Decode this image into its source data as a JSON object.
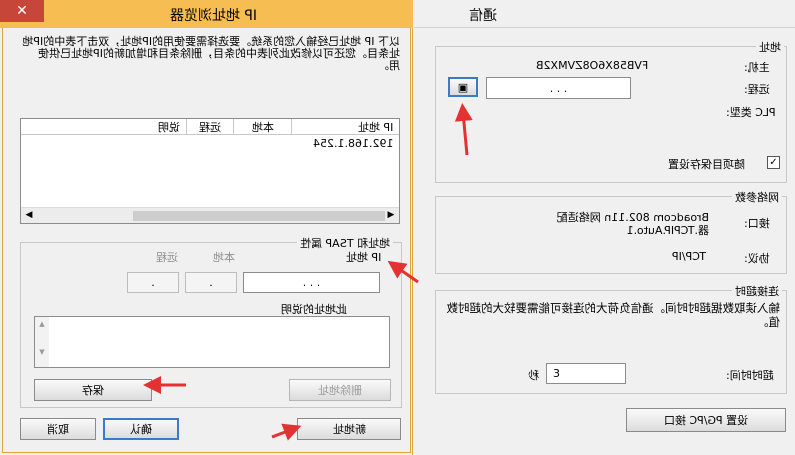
{
  "browser": {
    "title": "IP 地址浏览器",
    "close": "✕",
    "intro": "以下 IP 地址已经输入您的系统。要选择需要使用的IP地址，双击下表中的IP地址条目。您还可以修改此列表中的条目，删除条目和增加新的IP地址已供使用。",
    "table": {
      "columns": [
        "IP 地址",
        "本地",
        "远程",
        "说明"
      ],
      "rows": [
        [
          "192.168.1.254",
          "",
          "",
          ""
        ]
      ]
    },
    "group_title": "地址和 TSAP 属性",
    "ip_label": "IP 地址",
    "ip_value": ". . .",
    "local_label": "本地",
    "local_value": ".",
    "remote_label": "远程",
    "remote_value": ".",
    "desc_label": "此地址的说明",
    "save": "保存",
    "delete": "删除地址",
    "ok": "确认",
    "cancel": "取消",
    "new": "新地址"
  },
  "comm": {
    "title": "通信",
    "address_group": "地址",
    "host_label": "主机:",
    "host_value": "FVB58X6O8ZVMX2B",
    "remote_label": "远程:",
    "remote_value": ". . .",
    "plc_type_label": "PLC 类型:",
    "save_with_project_label": "随项目保存设置",
    "network_group": "网络参数",
    "interface_label": "接口:",
    "interface_value": "Broadcom 802.11n 网络适配器.TCPIP.Auto.1",
    "protocol_label": "协议:",
    "protocol_value": "TCP/IP",
    "timeout_group": "连接超时",
    "timeout_desc": "输入读取数据超时时间。通信负荷大的连接可能需要较大的超时数值。",
    "timeout_label": "超时时间:",
    "timeout_value": "3",
    "timeout_unit": "秒",
    "pg_pc_button": "设置 PG/PC 接口"
  },
  "colors": {
    "title_bar": "#f6bd52",
    "arrow": "#e43232"
  }
}
